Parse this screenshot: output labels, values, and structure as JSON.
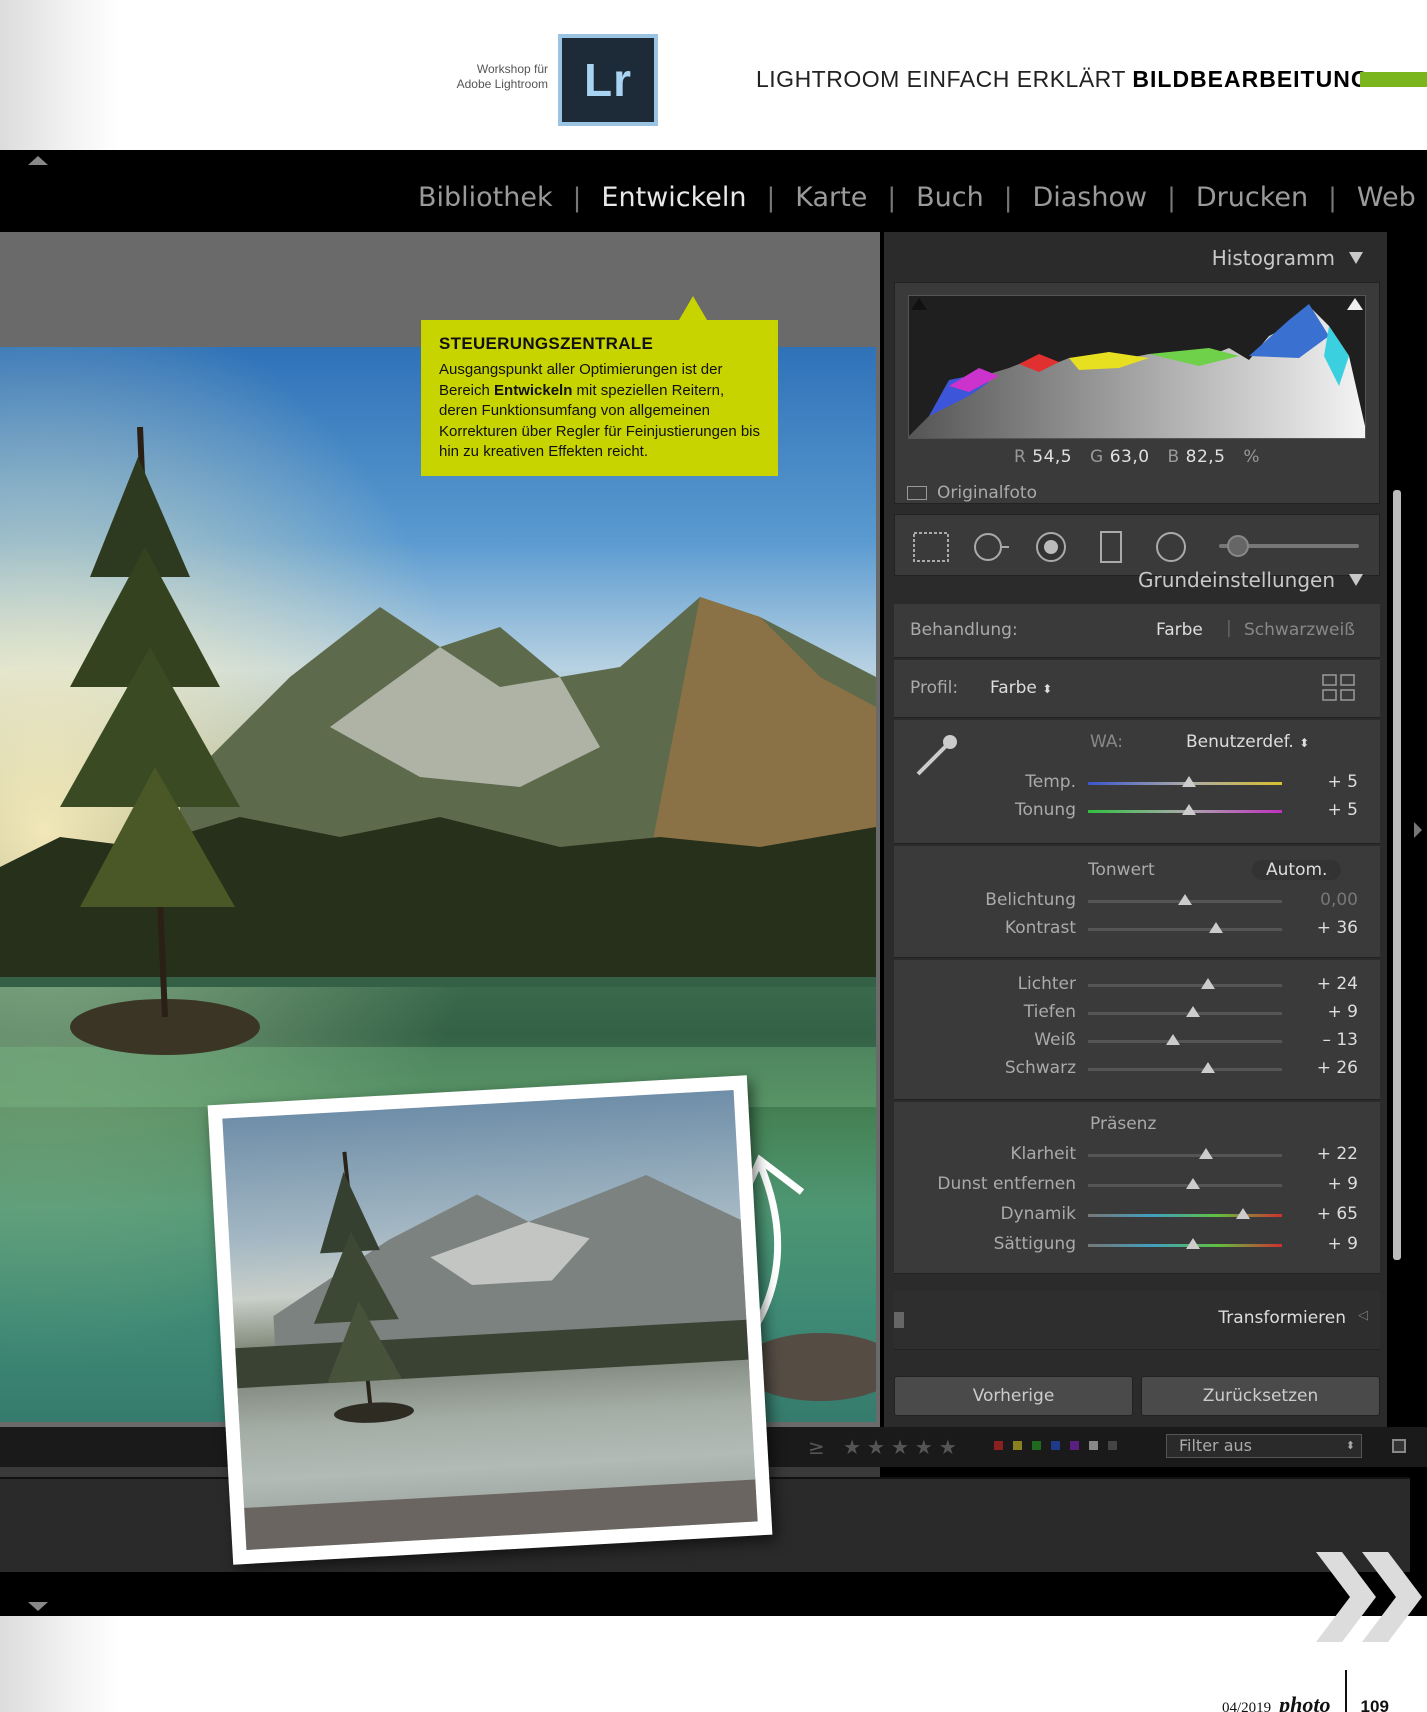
{
  "header": {
    "workshop_line1": "Workshop für",
    "workshop_line2": "Adobe Lightroom",
    "logo_text": "Lr",
    "title_prefix": "LIGHTROOM EINFACH ERKLÄRT",
    "title_bold": "BILDBEARBEITUNG",
    "accent_color": "#7ab51d"
  },
  "modules": [
    {
      "label": "Bibliothek",
      "active": false
    },
    {
      "label": "Entwickeln",
      "active": true
    },
    {
      "label": "Karte",
      "active": false
    },
    {
      "label": "Buch",
      "active": false
    },
    {
      "label": "Diashow",
      "active": false
    },
    {
      "label": "Drucken",
      "active": false
    },
    {
      "label": "Web",
      "active": false
    }
  ],
  "callout": {
    "title": "STEUERUNGSZENTRALE",
    "text_before": "Ausgangspunkt aller Optimierungen ist der Bereich ",
    "text_bold": "Entwickeln",
    "text_after": " mit speziellen Reitern, deren Funktionsumfang von allgemeinen Korrekturen über Regler für Feinjustierungen bis hin zu kreativen Effekten reicht.",
    "color": "#c8d400"
  },
  "histogram": {
    "title": "Histogramm",
    "r_label": "R",
    "r_value": "54,5",
    "g_label": "G",
    "g_value": "63,0",
    "b_label": "B",
    "b_value": "82,5",
    "percent": "%",
    "original_label": "Originalfoto"
  },
  "tools": [
    "crop-overlay-icon",
    "spot-removal-icon",
    "red-eye-icon",
    "graduated-filter-icon",
    "radial-filter-icon",
    "adjustment-brush-icon"
  ],
  "basic": {
    "title": "Grundeinstellungen",
    "treatment_label": "Behandlung:",
    "treatment_color": "Farbe",
    "treatment_bw": "Schwarzweiß",
    "profile_label": "Profil:",
    "profile_value": "Farbe",
    "wb_label": "WA:",
    "wb_value": "Benutzerdef.",
    "tone_label": "Tonwert",
    "auto_label": "Autom.",
    "presence_label": "Präsenz",
    "wb_sliders": [
      {
        "label": "Temp.",
        "value": "+ 5",
        "pos": 0.52
      },
      {
        "label": "Tonung",
        "value": "+ 5",
        "pos": 0.52
      }
    ],
    "tone_sliders": [
      {
        "label": "Belichtung",
        "value": "0,00",
        "pos": 0.5,
        "dim": true
      },
      {
        "label": "Kontrast",
        "value": "+ 36",
        "pos": 0.66
      }
    ],
    "tone_sliders2": [
      {
        "label": "Lichter",
        "value": "+ 24",
        "pos": 0.62
      },
      {
        "label": "Tiefen",
        "value": "+ 9",
        "pos": 0.54
      },
      {
        "label": "Weiß",
        "value": "– 13",
        "pos": 0.44
      },
      {
        "label": "Schwarz",
        "value": "+ 26",
        "pos": 0.62
      }
    ],
    "presence_sliders": [
      {
        "label": "Klarheit",
        "value": "+ 22",
        "pos": 0.61
      },
      {
        "label": "Dunst entfernen",
        "value": "+ 9",
        "pos": 0.54
      },
      {
        "label": "Dynamik",
        "value": "+ 65",
        "pos": 0.8
      },
      {
        "label": "Sättigung",
        "value": "+ 9",
        "pos": 0.54
      }
    ]
  },
  "transform_label": "Transformieren",
  "buttons": {
    "previous": "Vorherige",
    "reset": "Zurücksetzen"
  },
  "filter": {
    "ge": "≥",
    "stars": "★★★★★",
    "value": "Filter aus"
  },
  "footer": {
    "issue": "04/2019",
    "brand": "photo",
    "page": "109"
  }
}
